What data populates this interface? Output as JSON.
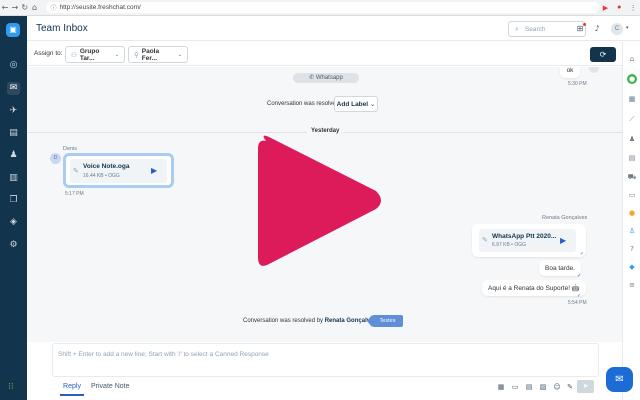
{
  "browser": {
    "url": "http://seusite.freshchat.com/",
    "back": "←",
    "forward": "→",
    "reload": "↻",
    "home": "⌂",
    "lock": "ⓘ",
    "ext_icons": [
      "▶",
      "●",
      "⋮"
    ]
  },
  "rail": {
    "logo": "▣",
    "icons": [
      "dashboard-icon",
      "inbox-icon",
      "campaigns-icon",
      "book-icon",
      "contacts-icon",
      "reports-icon",
      "bot-icon",
      "integrations-icon",
      "settings-icon"
    ],
    "glyphs": [
      "◎",
      "✉",
      "✈",
      "▤",
      "♟",
      "▥",
      "❐",
      "◈",
      "⚙"
    ],
    "apps_glyph": "⁝⁝"
  },
  "header": {
    "title": "Team Inbox",
    "search_placeholder": "Search",
    "search_glyph": "⌕",
    "apps_glyph": "⊞",
    "bell_glyph": "♪",
    "avatar_initial": "C",
    "caret": "▾"
  },
  "assign": {
    "label": "Assign to:",
    "group": "Grupo Tar...",
    "agent": "Paola Fer...",
    "group_glyph": "⚇",
    "agent_glyph": "⚲",
    "caret": "⌄",
    "refresh_glyph": "⟳"
  },
  "conversation": {
    "channel_pill": "Whatsapp",
    "channel_glyph": "✆",
    "resolved_text": "Conversation was resolved",
    "add_label": "Add Label",
    "add_label_caret": "⌄",
    "day_divider": "Yesterday",
    "top_message": {
      "text": "ok",
      "time": "5:30 PM"
    },
    "left_sender": "Denis",
    "left_avatar": "D",
    "voice_note": {
      "name": "Voice Note.oga",
      "meta": "16.44 KB • OGG",
      "time": "5:17 PM"
    },
    "clip_glyph": "✎",
    "play_glyph": "▶",
    "right_sender": "Renata Gonçalves",
    "whatsapp_file": {
      "name": "WhatsApp Ptt 2020...",
      "meta": "6.97 KB • OGG"
    },
    "bubble1": "Boa tarde.",
    "bubble2": "Aqui é a Renata do Suporte! 🤖",
    "tick_glyph": "✓",
    "right_time": "5:54 PM",
    "resolved_by_prefix": "Conversation was resolved by",
    "resolved_by_name": "Renata Gonçalves",
    "resolved_by_suffix": "as",
    "tag": "Testes"
  },
  "composer": {
    "placeholder": "Shift + Enter to add a new line; Start with '/' to select a Canned Response",
    "tab_reply": "Reply",
    "tab_private": "Private Note",
    "tools": [
      "calendar-icon",
      "note-icon",
      "article-icon",
      "image-icon",
      "emoji-icon",
      "attach-icon"
    ],
    "tool_glyphs": [
      "▦",
      "▭",
      "▤",
      "▨",
      "☺",
      "✎"
    ],
    "send_glyph": "➤"
  },
  "right_panel": {
    "icons": [
      "home-icon",
      "whatsapp-icon",
      "grid-icon",
      "chart-icon",
      "person-icon",
      "cart-icon",
      "truck-icon",
      "ticket-icon",
      "coin-icon",
      "user-icon",
      "help-icon",
      "app-icon",
      "sliders-icon"
    ],
    "glyphs": [
      "⌂",
      "●",
      "▦",
      "⟋",
      "♟",
      "▤",
      "⛟",
      "▭",
      "●",
      "♙",
      "?",
      "◆",
      "≡"
    ],
    "colors": [
      "#6b7b89",
      "#3db44b",
      "#6b7b89",
      "#6b7b89",
      "#6b7b89",
      "#6b7b89",
      "#6b7b89",
      "#6b7b89",
      "#f5a623",
      "#2c9bf0",
      "#6b7b89",
      "#2c9bf0",
      "#6b7b89"
    ]
  },
  "chat_widget_glyph": "✉",
  "colors": {
    "rail": "#12344d",
    "accent": "#2c5cc5",
    "play": "#dd1b5b",
    "tag": "#5f8fd6"
  }
}
